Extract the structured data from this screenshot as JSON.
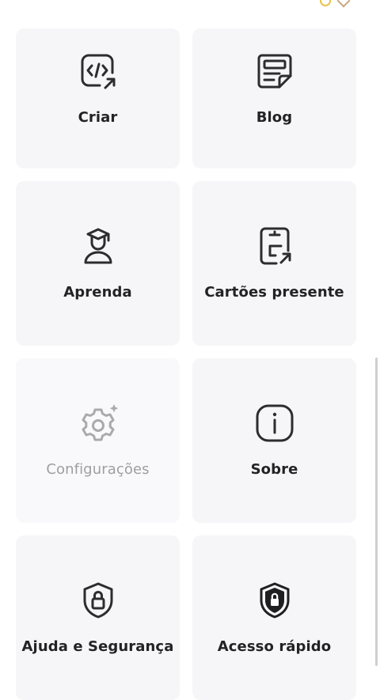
{
  "tiles": [
    {
      "label": "Criar",
      "icon": "code-share-icon",
      "enabled": true
    },
    {
      "label": "Blog",
      "icon": "blog-document-icon",
      "enabled": true
    },
    {
      "label": "Aprenda",
      "icon": "graduate-icon",
      "enabled": true
    },
    {
      "label": "Cartões presente",
      "icon": "gift-card-icon",
      "enabled": true
    },
    {
      "label": "Configurações",
      "icon": "settings-gear-icon",
      "enabled": false
    },
    {
      "label": "Sobre",
      "icon": "info-icon",
      "enabled": true
    },
    {
      "label": "Ajuda e Segurança",
      "icon": "shield-lock-outline-icon",
      "enabled": true
    },
    {
      "label": "Acesso rápido",
      "icon": "shield-lock-filled-icon",
      "enabled": true
    }
  ],
  "colors": {
    "tile_bg": "#f6f6f8",
    "text": "#232326",
    "disabled_text": "#9e9ea3"
  }
}
